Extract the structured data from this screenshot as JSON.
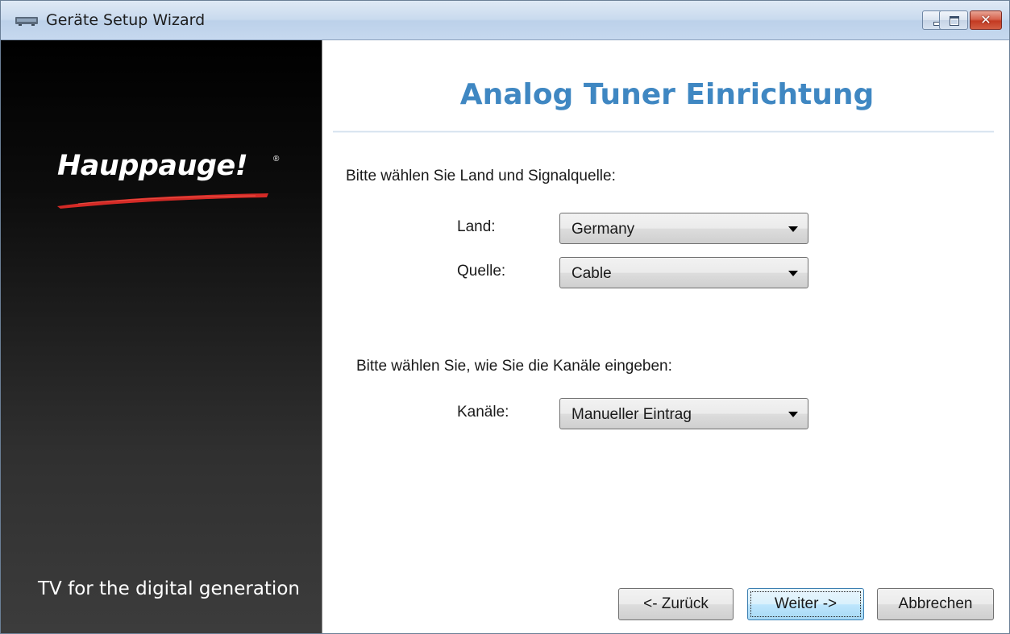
{
  "window": {
    "title": "Geräte Setup Wizard",
    "icon": "device-icon"
  },
  "controls": {
    "minimize": "minimize-icon",
    "maximize": "maximize-icon",
    "close": "✕"
  },
  "sidebar": {
    "logo": "Hauppauge!",
    "logo_mark": "®",
    "tagline": "TV for the digital generation"
  },
  "main": {
    "heading": "Analog Tuner Einrichtung",
    "section1_prompt": "Bitte wählen Sie Land und Signalquelle:",
    "land_label": "Land:",
    "land_value": "Germany",
    "quelle_label": "Quelle:",
    "quelle_value": "Cable",
    "section2_prompt": "Bitte wählen Sie, wie Sie die Kanäle eingeben:",
    "kanaele_label": "Kanäle:",
    "kanaele_value": "Manueller Eintrag"
  },
  "buttons": {
    "back": "<- Zurück",
    "next": "Weiter ->",
    "cancel": "Abbrechen"
  },
  "colors": {
    "heading": "#3f87c2",
    "sidebar": "#000000",
    "swoosh": "#d42a26"
  }
}
